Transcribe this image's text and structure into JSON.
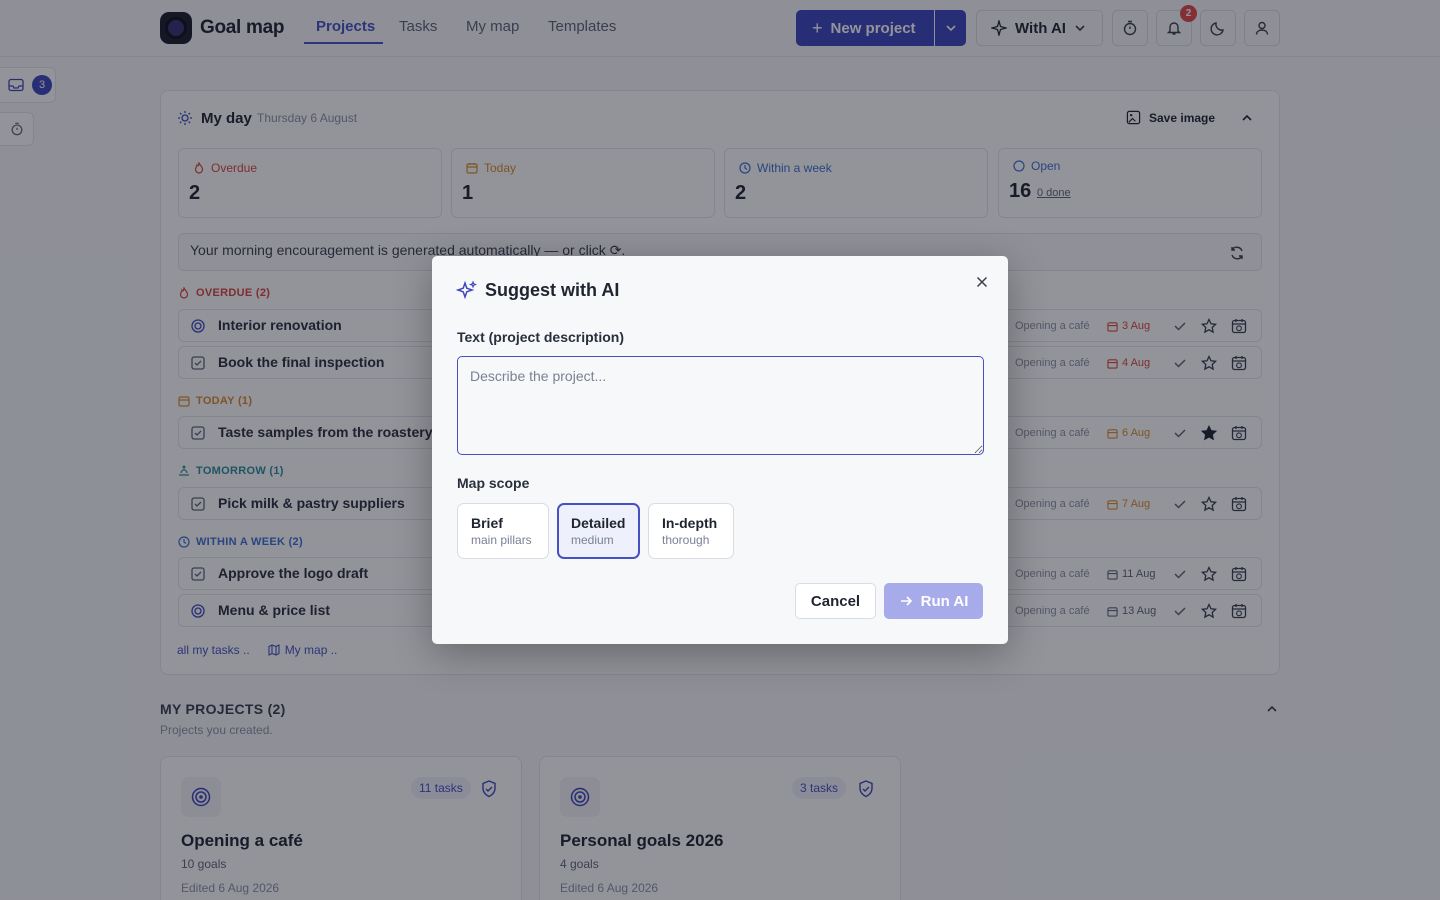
{
  "header": {
    "app_name": "Goal map",
    "nav": [
      "Projects",
      "Tasks",
      "My map",
      "Templates"
    ],
    "new_project_label": "New project",
    "with_ai_label": "With AI",
    "notifications_count": "2"
  },
  "side": {
    "inbox_count": "3"
  },
  "my_day": {
    "title": "My day",
    "date": "Thursday 6 August",
    "save_image_label": "Save image",
    "stats": [
      {
        "label": "Overdue",
        "value": "2",
        "color": "#d9453d"
      },
      {
        "label": "Today",
        "value": "1",
        "color": "#d98a2a"
      },
      {
        "label": "Within a week",
        "value": "2",
        "color": "#3b6fd1"
      },
      {
        "label": "Open",
        "value": "16",
        "sub": "0 done",
        "color": "#3b6fd1"
      }
    ],
    "encouragement": "Your morning encouragement is generated automatically — or click ⟳."
  },
  "sections": {
    "overdue": "OVERDUE (2)",
    "today": "TODAY (1)",
    "tomorrow": "TOMORROW (1)",
    "week": "WITHIN A WEEK (2)"
  },
  "tasks": [
    {
      "title": "Interior renovation",
      "project": "Opening a café",
      "due": "3 Aug"
    },
    {
      "title": "Book the final inspection",
      "project": "Opening a café",
      "due": "4 Aug"
    },
    {
      "title": "Taste samples from the roastery",
      "project": "Opening a café",
      "due": "6 Aug"
    },
    {
      "title": "Pick milk & pastry suppliers",
      "project": "Opening a café",
      "due": "7 Aug"
    },
    {
      "title": "Approve the logo draft",
      "project": "Opening a café",
      "due": "11 Aug"
    },
    {
      "title": "Menu & price list",
      "project": "Opening a café",
      "due": "13 Aug"
    }
  ],
  "footer_links": {
    "all_tasks": "all my tasks ..",
    "my_map": "My map .."
  },
  "projects": {
    "heading": "MY PROJECTS (2)",
    "subtitle": "Projects you created.",
    "cards": [
      {
        "tasks": "11 tasks",
        "title": "Opening a café",
        "goals": "10 goals",
        "edited": "Edited 6 Aug 2026"
      },
      {
        "tasks": "3 tasks",
        "title": "Personal goals 2026",
        "goals": "4 goals",
        "edited": "Edited 6 Aug 2026"
      }
    ]
  },
  "modal": {
    "title": "Suggest with AI",
    "text_label": "Text (project description)",
    "text_placeholder": "Describe the project...",
    "text_value": "",
    "scope_label": "Map scope",
    "scopes": [
      {
        "title": "Brief",
        "sub": "main pillars"
      },
      {
        "title": "Detailed",
        "sub": "medium",
        "selected": true
      },
      {
        "title": "In-depth",
        "sub": "thorough"
      }
    ],
    "cancel_label": "Cancel",
    "run_label": "Run AI"
  }
}
